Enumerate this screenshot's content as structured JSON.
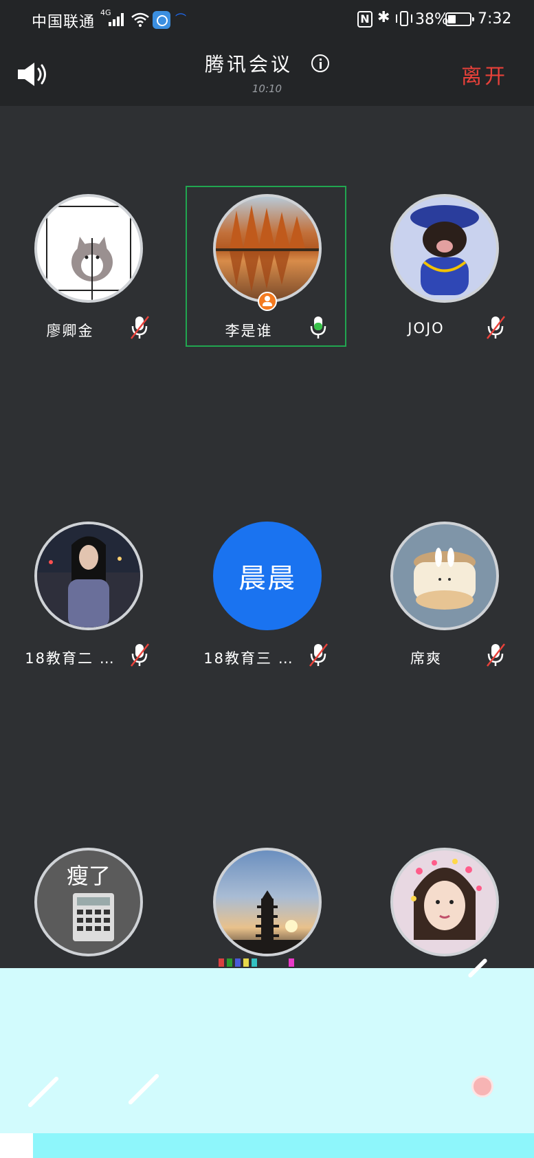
{
  "status_bar": {
    "carrier": "中国联通",
    "network": "4G",
    "battery_percent": "38%",
    "battery_level": 0.38,
    "time": "7:32",
    "icons": [
      "signal-icon",
      "wifi-icon",
      "app-icon",
      "app-icon",
      "nfc-icon",
      "bluetooth-icon",
      "vibrate-icon",
      "battery-icon"
    ]
  },
  "header": {
    "title": "腾讯会议",
    "duration": "10:10",
    "leave_label": "离开",
    "colors": {
      "leave": "#e8413a",
      "active_border": "#21a650",
      "host_badge": "#f47a20",
      "text_avatar": "#1a73f0"
    }
  },
  "participants": [
    {
      "name": "廖卿金",
      "mic": "muted",
      "avatar": "cartoon-dog"
    },
    {
      "name": "李是谁",
      "mic": "active",
      "avatar": "autumn-trees",
      "host": true,
      "speaking": true
    },
    {
      "name": "JOJO",
      "mic": "muted",
      "avatar": "dog-costume"
    },
    {
      "name": "18教育二 …",
      "mic": "muted",
      "avatar": "girl-night"
    },
    {
      "name": "18教育三 …",
      "mic": "muted",
      "avatar_text": "晨晨"
    },
    {
      "name": "席爽",
      "mic": "muted",
      "avatar": "bunny-jar"
    },
    {
      "name": "",
      "mic": "muted",
      "avatar": "calculator",
      "avatar_caption": "瘦了"
    },
    {
      "name": "",
      "mic": "",
      "avatar": "pagoda-sunset"
    },
    {
      "name": "",
      "mic": "",
      "avatar": "girl-hearts"
    }
  ]
}
